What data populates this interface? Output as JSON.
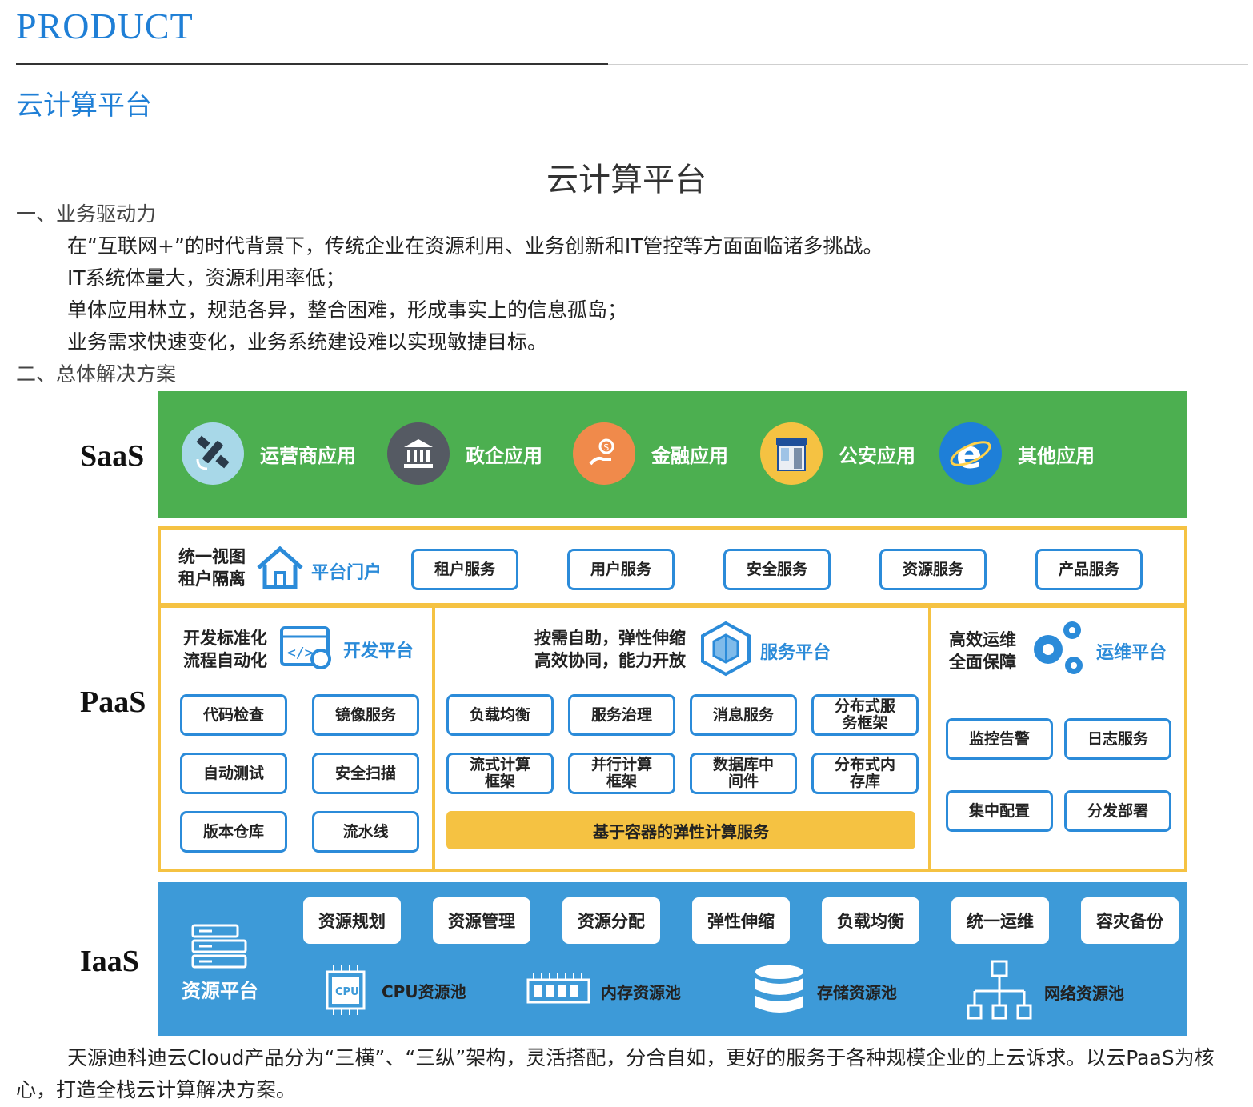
{
  "header": {
    "product_label": "PRODUCT",
    "section_title": "云计算平台"
  },
  "article": {
    "title": "云计算平台",
    "heading1": "一、业务驱动力",
    "paragraphs": [
      "在“互联网+”的时代背景下，传统企业在资源利用、业务创新和IT管控等方面面临诸多挑战。",
      "IT系统体量大，资源利用率低；",
      "单体应用林立，规范各异，整合困难，形成事实上的信息孤岛；",
      "业务需求快速变化，业务系统建设难以实现敏捷目标。"
    ],
    "heading2": "二、总体解决方案",
    "footer": "天源迪科迪云Cloud产品分为“三横”、“三纵”架构，灵活搭配，分合自如，更好的服务于各种规模企业的上云诉求。以云PaaS为核心，打造全栈云计算解决方案。"
  },
  "diagram": {
    "saas": {
      "label": "SaaS",
      "items": [
        {
          "label": "运营商应用",
          "icon": "satellite-icon",
          "color": "#a8d8e8"
        },
        {
          "label": "政企应用",
          "icon": "government-building-icon",
          "color": "#555a63"
        },
        {
          "label": "金融应用",
          "icon": "finance-hand-coin-icon",
          "color": "#f08a4b"
        },
        {
          "label": "公安应用",
          "icon": "police-booth-icon",
          "color": "#f5c242"
        },
        {
          "label": "其他应用",
          "icon": "browser-e-icon",
          "color": "#1e7fd8"
        }
      ]
    },
    "paas": {
      "label": "PaaS",
      "portal": {
        "tag": [
          "统一视图",
          "租户隔离"
        ],
        "icon": "house-icon",
        "name": "平台门户",
        "services": [
          "租户服务",
          "用户服务",
          "安全服务",
          "资源服务",
          "产品服务"
        ]
      },
      "dev": {
        "tag": [
          "开发标准化",
          "流程自动化"
        ],
        "icon": "code-gear-icon",
        "name": "开发平台",
        "items": [
          "代码检查",
          "镜像服务",
          "自动测试",
          "安全扫描",
          "版本仓库",
          "流水线"
        ]
      },
      "service": {
        "tag": [
          "按需自助，弹性伸缩",
          "高效协同，能力开放"
        ],
        "icon": "cube-network-icon",
        "name": "服务平台",
        "items": [
          "负载均衡",
          "服务治理",
          "消息服务",
          "分布式服务框架",
          "流式计算框架",
          "并行计算框架",
          "数据库中间件",
          "分布式内存库"
        ],
        "bar": "基于容器的弹性计算服务"
      },
      "ops": {
        "tag": [
          "高效运维",
          "全面保障"
        ],
        "icon": "gears-icon",
        "name": "运维平台",
        "items": [
          "监控告警",
          "日志服务",
          "集中配置",
          "分发部署"
        ]
      }
    },
    "iaas": {
      "label": "IaaS",
      "platform": {
        "label": "资源平台",
        "icon": "server-stack-icon"
      },
      "services": [
        "资源规划",
        "资源管理",
        "资源分配",
        "弹性伸缩",
        "负载均衡",
        "统一运维",
        "容灾备份"
      ],
      "pools": [
        {
          "label": "CPU资源池",
          "icon": "cpu-icon",
          "chip_text": "CPU"
        },
        {
          "label": "内存资源池",
          "icon": "memory-icon"
        },
        {
          "label": "存储资源池",
          "icon": "database-icon"
        },
        {
          "label": "网络资源池",
          "icon": "network-topology-icon"
        }
      ]
    },
    "colors": {
      "saas_green": "#4caf50",
      "paas_border": "#f5c242",
      "iaas_blue": "#3d9ad8",
      "accent_blue": "#2b8bd9",
      "title_blue": "#1f7fd6"
    }
  }
}
